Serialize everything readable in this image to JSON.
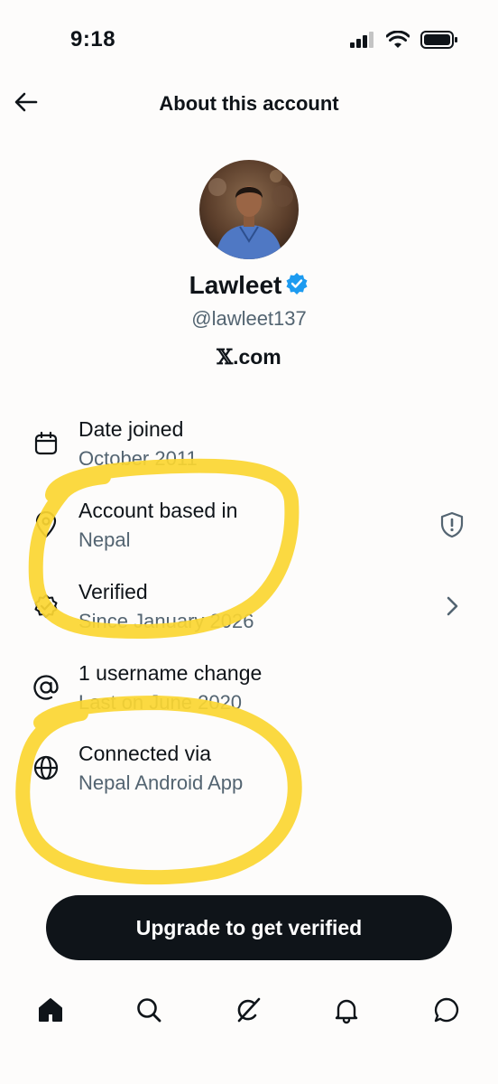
{
  "status_bar": {
    "time": "9:18",
    "icons": [
      "signal-icon",
      "wifi-icon",
      "battery-icon"
    ]
  },
  "header": {
    "title": "About this account",
    "back_icon": "arrow-left-icon"
  },
  "profile": {
    "name": "Lawleet",
    "verified_badge": "verified-badge-icon",
    "handle": "@lawleet137",
    "site_x": "𝕏",
    "site_domain": ".com"
  },
  "info": [
    {
      "icon": "calendar-icon",
      "title": "Date joined",
      "subtitle": "October 2011"
    },
    {
      "icon": "location-pin-icon",
      "title": "Account based in",
      "subtitle": "Nepal",
      "trailing_icon": "shield-alert-icon"
    },
    {
      "icon": "verified-check-icon",
      "title": "Verified",
      "subtitle": "Since January 2026",
      "trailing_icon": "chevron-right-icon"
    },
    {
      "icon": "at-sign-icon",
      "title": "1 username change",
      "subtitle": "Last on June 2020"
    },
    {
      "icon": "globe-icon",
      "title": "Connected via",
      "subtitle": "Nepal Android App"
    }
  ],
  "cta": {
    "label": "Upgrade to get verified"
  },
  "tabs": [
    "home-icon",
    "search-icon",
    "grok-icon",
    "notifications-icon",
    "messages-icon"
  ],
  "colors": {
    "text_primary": "#0f1419",
    "text_secondary": "#536471",
    "verified_blue": "#1d9bf0",
    "highlighter_yellow": "#fbd631",
    "button_bg": "#0f1419"
  }
}
